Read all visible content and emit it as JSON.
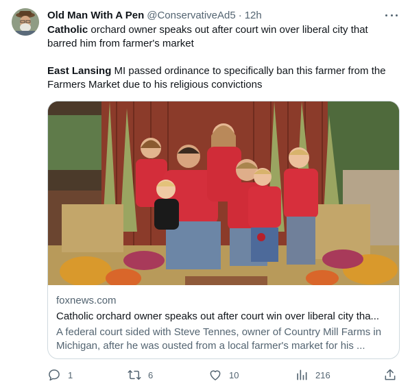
{
  "author": {
    "display_name": "Old Man With A Pen",
    "handle": "@ConservativeAd5",
    "separator": "·",
    "timestamp": "12h",
    "avatar_icon": "avatar-photo"
  },
  "tweet": {
    "para1_bold": "Catholic",
    "para1_rest": " orchard owner speaks out after court win over liberal city that barred him from farmer's market",
    "para2_bold": "East Lansing",
    "para2_rest": " MI passed ordinance to specifically ban this farmer from the Farmers Market due to his religious convictions"
  },
  "card": {
    "domain": "foxnews.com",
    "title": "Catholic orchard owner speaks out after court win over liberal city tha...",
    "description": "A federal court sided with Steve Tennes, owner of Country Mill Farms in Michigan, after he was ousted from a local farmer's market for his ..."
  },
  "actions": {
    "replies": "1",
    "retweets": "6",
    "likes": "10",
    "views": "216"
  },
  "colors": {
    "text": "#0f1419",
    "secondary": "#536471",
    "border": "#cfd9de"
  }
}
